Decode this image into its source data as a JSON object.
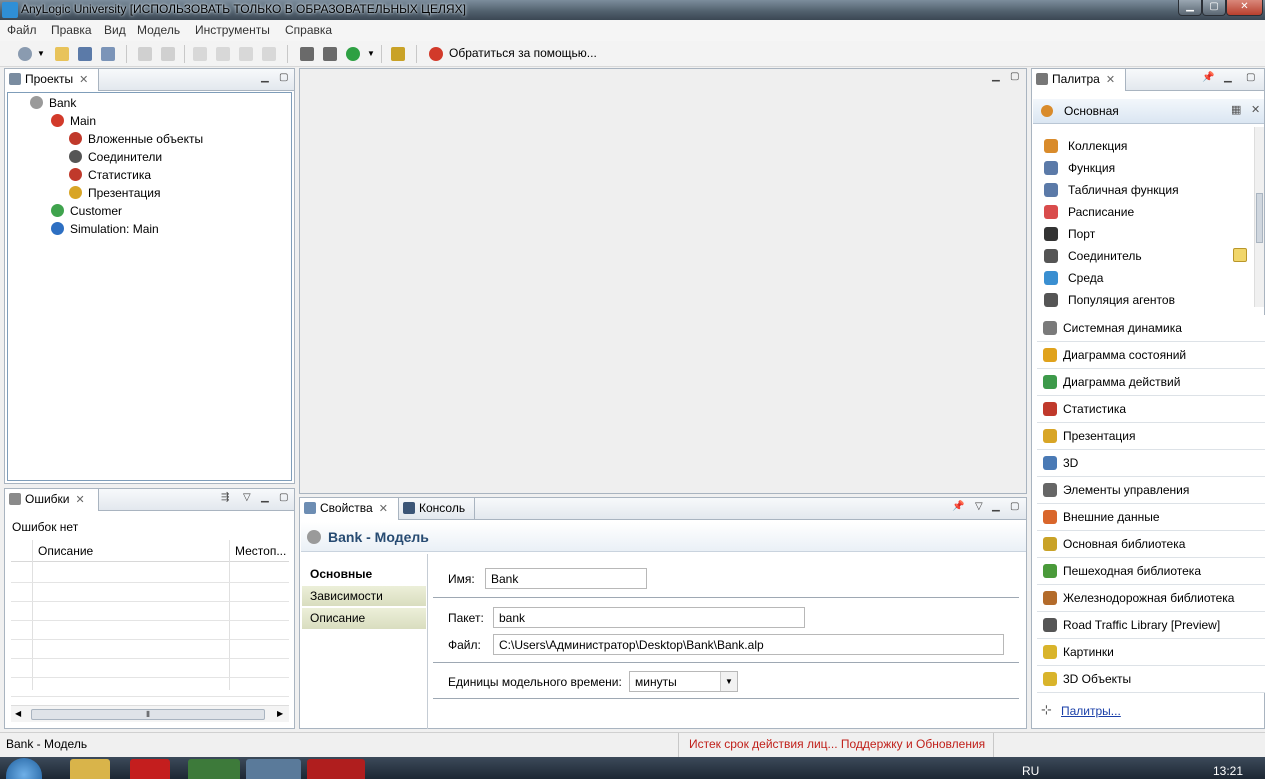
{
  "window": {
    "title": "AnyLogic University [ИСПОЛЬЗОВАТЬ ТОЛЬКО В ОБРАЗОВАТЕЛЬНЫХ ЦЕЛЯХ]"
  },
  "menu": [
    "Файл",
    "Правка",
    "Вид",
    "Модель",
    "Инструменты",
    "Справка"
  ],
  "toolbar": {
    "help_label": "Обратиться за помощью..."
  },
  "projects": {
    "tab_label": "Проекты",
    "tree": [
      {
        "label": "Bank",
        "level": 0,
        "icon": "project-icon",
        "color": "#9a9a9a"
      },
      {
        "label": "Main",
        "level": 1,
        "icon": "agent-icon",
        "color": "#d23a2a"
      },
      {
        "label": "Вложенные объекты",
        "level": 2,
        "icon": "embedded-objects-icon",
        "color": "#c0392b"
      },
      {
        "label": "Соединители",
        "level": 2,
        "icon": "connectors-icon",
        "color": "#555555"
      },
      {
        "label": "Статистика",
        "level": 2,
        "icon": "statistics-icon",
        "color": "#c0392b"
      },
      {
        "label": "Презентация",
        "level": 2,
        "icon": "presentation-icon",
        "color": "#d8a526"
      },
      {
        "label": "Customer",
        "level": 1,
        "icon": "class-icon",
        "color": "#3fa34d"
      },
      {
        "label": "Simulation: Main",
        "level": 1,
        "icon": "experiment-icon",
        "color": "#2d6fc2"
      }
    ]
  },
  "errors": {
    "tab_label": "Ошибки",
    "status": "Ошибок нет",
    "columns": [
      "Описание",
      "Местоп..."
    ]
  },
  "properties": {
    "tabs": [
      "Свойства",
      "Консоль"
    ],
    "title": "Bank - Модель",
    "side_tabs": [
      "Основные",
      "Зависимости",
      "Описание"
    ],
    "name_label": "Имя:",
    "name_value": "Bank",
    "package_label": "Пакет:",
    "package_value": "bank",
    "file_label": "Файл:",
    "file_value": "C:\\Users\\Администратор\\Desktop\\Bank\\Bank.alp",
    "time_units_label": "Единицы модельного времени:",
    "time_units_value": "минуты"
  },
  "palette": {
    "tab_label": "Палитра",
    "section": "Основная",
    "items": [
      {
        "label": "Коллекция",
        "icon": "collection-icon",
        "color": "#d98b2b"
      },
      {
        "label": "Функция",
        "icon": "function-icon",
        "color": "#5b7aa8"
      },
      {
        "label": "Табличная функция",
        "icon": "table-function-icon",
        "color": "#5b7aa8"
      },
      {
        "label": "Расписание",
        "icon": "schedule-icon",
        "color": "#d94c4c"
      },
      {
        "label": "Порт",
        "icon": "port-icon",
        "color": "#333333"
      },
      {
        "label": "Соединитель",
        "icon": "connector-icon",
        "color": "#555555"
      },
      {
        "label": "Среда",
        "icon": "environment-icon",
        "color": "#3a8fd1"
      },
      {
        "label": "Популяция агентов",
        "icon": "agent-population-icon",
        "color": "#555555"
      }
    ],
    "categories": [
      {
        "label": "Системная динамика",
        "icon": "system-dynamics-icon",
        "color": "#7a7a7a"
      },
      {
        "label": "Диаграмма состояний",
        "icon": "statechart-icon",
        "color": "#e0a21c"
      },
      {
        "label": "Диаграмма действий",
        "icon": "action-chart-icon",
        "color": "#3d9a4a"
      },
      {
        "label": "Статистика",
        "icon": "statistics-icon",
        "color": "#c0392b"
      },
      {
        "label": "Презентация",
        "icon": "presentation-icon",
        "color": "#d8a526"
      },
      {
        "label": "3D",
        "icon": "3d-icon",
        "color": "#4a7ab5"
      },
      {
        "label": "Элементы управления",
        "icon": "controls-icon",
        "color": "#666666"
      },
      {
        "label": "Внешние данные",
        "icon": "external-data-icon",
        "color": "#d9662b"
      },
      {
        "label": "Основная библиотека",
        "icon": "enterprise-library-icon",
        "color": "#c9a227"
      },
      {
        "label": "Пешеходная библиотека",
        "icon": "pedestrian-library-icon",
        "color": "#4a9a3a"
      },
      {
        "label": "Железнодорожная библиотека",
        "icon": "rail-library-icon",
        "color": "#b36b2b"
      },
      {
        "label": "Road Traffic Library [Preview]",
        "icon": "road-traffic-icon",
        "color": "#555555"
      },
      {
        "label": "Картинки",
        "icon": "pictures-icon",
        "color": "#d9b42b"
      },
      {
        "label": "3D Объекты",
        "icon": "3d-objects-icon",
        "color": "#d9b42b"
      }
    ],
    "more_link": "Палитры..."
  },
  "status": {
    "left": "Bank - Модель",
    "license": "Истек срок действия лиц... Поддержку и Обновления"
  },
  "taskbar": {
    "lang": "RU",
    "time": "13:21"
  }
}
